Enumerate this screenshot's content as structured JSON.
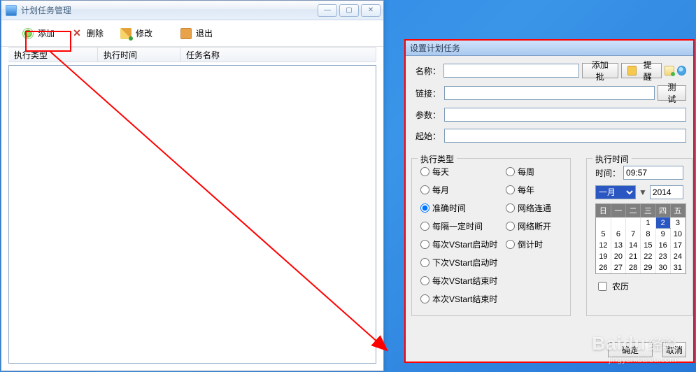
{
  "left": {
    "title": "计划任务管理",
    "toolbar": {
      "add": "添加",
      "delete": "删除",
      "edit": "修改",
      "exit": "退出"
    },
    "grid_headers": {
      "exec_type": "执行类型",
      "exec_time": "执行时间",
      "task_name": "任务名称"
    }
  },
  "right": {
    "title": "设置计划任务",
    "labels": {
      "name": "名称：",
      "link": "链接：",
      "params": "参数：",
      "start": "起始："
    },
    "buttons": {
      "add_batch": "添加批",
      "remind": "提醒",
      "test": "测试",
      "ok": "确定",
      "cancel": "取消"
    },
    "exec_group": {
      "legend": "执行类型",
      "left": [
        "每天",
        "每月",
        "准确时间",
        "每隔一定时间",
        "每次VStart启动时",
        "下次VStart启动时",
        "每次VStart结束时",
        "本次VStart结束时"
      ],
      "right": [
        "每周",
        "每年",
        "网络连通",
        "网络断开",
        "倒计时"
      ],
      "selected_index": 2
    },
    "time_group": {
      "legend": "执行时间",
      "time_label": "时间：",
      "time_value": "09:57",
      "month": "一月",
      "year": "2014",
      "weekdays": [
        "日",
        "一",
        "二",
        "三",
        "四",
        "五"
      ],
      "days": [
        [
          "",
          "",
          "",
          "1",
          "2",
          "3"
        ],
        [
          "5",
          "6",
          "7",
          "8",
          "9",
          "10"
        ],
        [
          "12",
          "13",
          "14",
          "15",
          "16",
          "17"
        ],
        [
          "19",
          "20",
          "21",
          "22",
          "23",
          "24"
        ],
        [
          "26",
          "27",
          "28",
          "29",
          "30",
          "31"
        ]
      ],
      "selected_day": "2",
      "lunar": "农历"
    }
  },
  "watermark": {
    "brand": "Baidu",
    "cn": "经验",
    "url": "jingyan.baidu.com"
  }
}
